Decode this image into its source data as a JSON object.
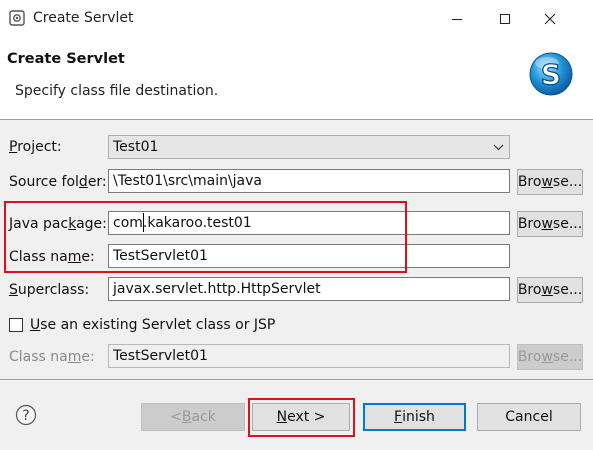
{
  "window": {
    "title": "Create Servlet"
  },
  "banner": {
    "title": "Create Servlet",
    "description": "Specify class file destination."
  },
  "form": {
    "project": {
      "label_pre": "",
      "label_u": "P",
      "label_post": "roject:",
      "value": "Test01"
    },
    "source_folder": {
      "label_pre": "Source fol",
      "label_u": "d",
      "label_post": "er:",
      "value": "\\Test01\\src\\main\\java"
    },
    "java_package": {
      "label_pre": "Java pac",
      "label_u": "k",
      "label_post": "age:",
      "value": "com.kakaroo.test01"
    },
    "class_name": {
      "label_pre": "Class na",
      "label_u": "m",
      "label_post": "e:",
      "value": "TestServlet01"
    },
    "superclass": {
      "label_pre": "",
      "label_u": "S",
      "label_post": "uperclass:",
      "value": "javax.servlet.http.HttpServlet"
    },
    "existing": {
      "label_pre": "",
      "label_u": "U",
      "label_post": "se an existing Servlet class or JSP",
      "checked": false
    },
    "existing_class": {
      "label_pre": "Class na",
      "label_u": "m",
      "label_post": "e:",
      "value": "TestServlet01"
    },
    "browse": {
      "pre": "Bro",
      "u": "w",
      "post": "se..."
    }
  },
  "footer": {
    "back": {
      "pre": "< ",
      "u": "B",
      "post": "ack"
    },
    "next": {
      "pre": "",
      "u": "N",
      "post": "ext >"
    },
    "finish": {
      "pre": "",
      "u": "F",
      "post": "inish"
    },
    "cancel": "Cancel"
  },
  "colors": {
    "highlight": "#e0101a",
    "accent": "#0078d7"
  }
}
